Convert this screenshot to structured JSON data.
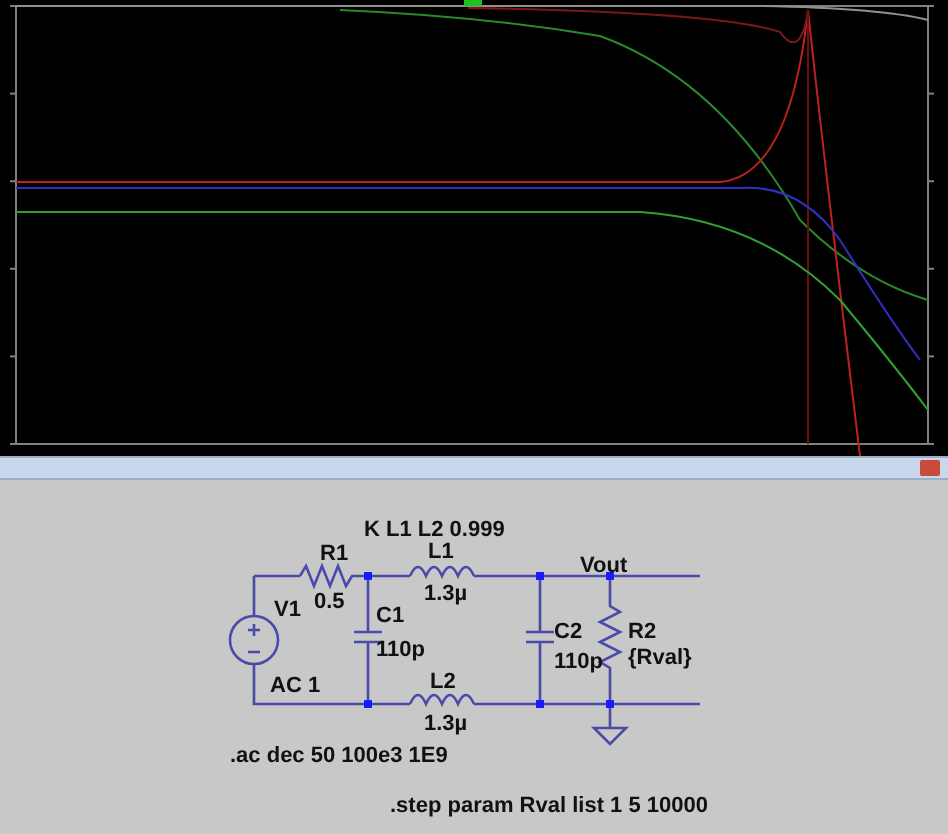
{
  "schematic": {
    "coupling": "K L1 L2 0.999",
    "components": [
      {
        "name": "V1",
        "value": "AC 1"
      },
      {
        "name": "R1",
        "value": "0.5"
      },
      {
        "name": "C1",
        "value": "110p"
      },
      {
        "name": "L1",
        "value": "1.3µ"
      },
      {
        "name": "L2",
        "value": "1.3µ"
      },
      {
        "name": "C2",
        "value": "110p"
      },
      {
        "name": "R2",
        "value": "{Rval}"
      }
    ],
    "net_label": "Vout",
    "directives": [
      ".ac dec 50 100e3 1E9",
      ".step param Rval list 1 5 10000"
    ]
  }
}
